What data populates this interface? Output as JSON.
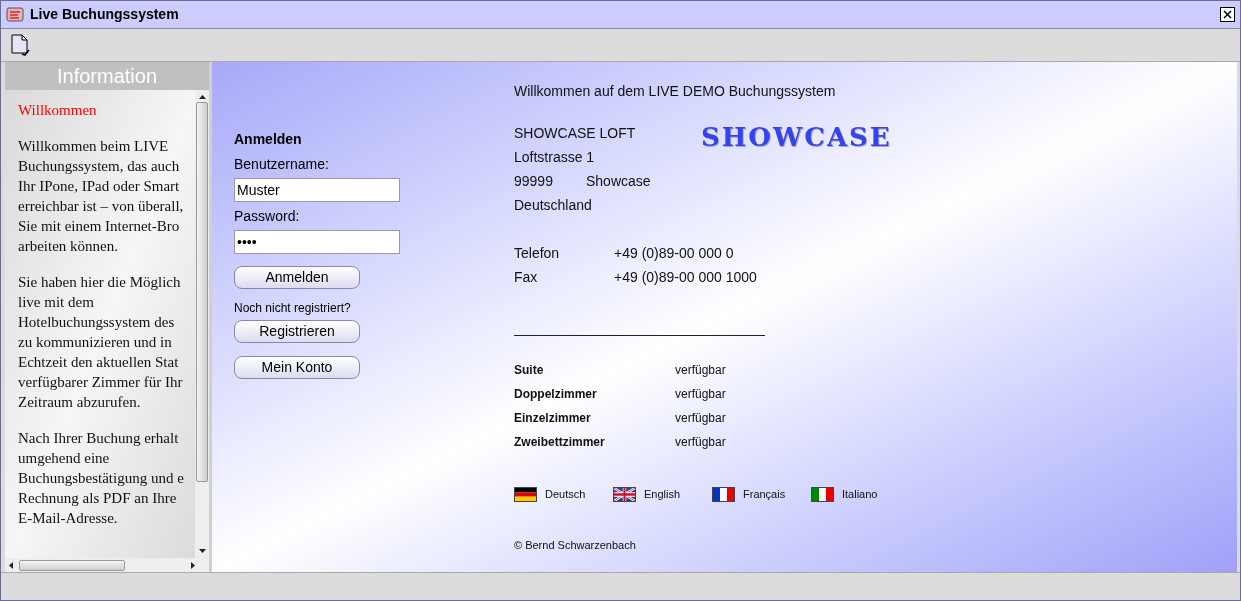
{
  "window": {
    "title": "Live Buchungssystem"
  },
  "sidebar": {
    "title": "Information",
    "heading": "Willkommen",
    "paragraphs": [
      [
        "Willkommen beim LIVE",
        "Buchungssystem, das auch",
        "Ihr IPone, IPad oder Smart",
        "erreichbar ist – von überall,",
        "Sie mit einem Internet-Bro",
        "arbeiten können."
      ],
      [
        "Sie haben hier die Möglich",
        "live mit dem",
        "Hotelbuchungssystem des",
        "zu kommunizieren und in",
        "Echtzeit den aktuellen Stat",
        "verfügbarer Zimmer für Ihr",
        "Zeitraum abzurufen."
      ],
      [
        "Nach Ihrer Buchung erhalt",
        "umgehend eine",
        "Buchungsbestätigung und e",
        "Rechnung als PDF an Ihre",
        "E-Mail-Adresse."
      ]
    ]
  },
  "login": {
    "title": "Anmelden",
    "username_label": "Benutzername:",
    "username": "Muster",
    "password_label": "Password:",
    "password": "••••",
    "login_button": "Anmelden",
    "register_prompt": "Noch nicht registriert?",
    "register_button": "Registrieren",
    "account_button": "Mein Konto"
  },
  "welcome": "Willkommen auf dem LIVE DEMO Buchungssystem",
  "address": {
    "name": "SHOWCASE LOFT",
    "street": "Loftstrasse 1",
    "zip": "99999",
    "city": "Showcase",
    "country": "Deutschland"
  },
  "logo": "SHOWCASE",
  "contacts": [
    {
      "label": "Telefon",
      "value": "+49 (0)89-00 000 0"
    },
    {
      "label": "Fax",
      "value": "+49 (0)89-00 000 1000"
    }
  ],
  "rooms": [
    {
      "name": "Suite",
      "status": "verfügbar"
    },
    {
      "name": "Doppelzimmer",
      "status": "verfügbar"
    },
    {
      "name": "Einzelzimmer",
      "status": "verfügbar"
    },
    {
      "name": "Zweibettzimmer",
      "status": "verfügbar"
    }
  ],
  "languages": [
    {
      "kind": "de",
      "label": "Deutsch"
    },
    {
      "kind": "en",
      "label": "English"
    },
    {
      "kind": "fr",
      "label": "Français"
    },
    {
      "kind": "it",
      "label": "Italiano"
    }
  ],
  "footer": "© Bernd Schwarzenbach"
}
